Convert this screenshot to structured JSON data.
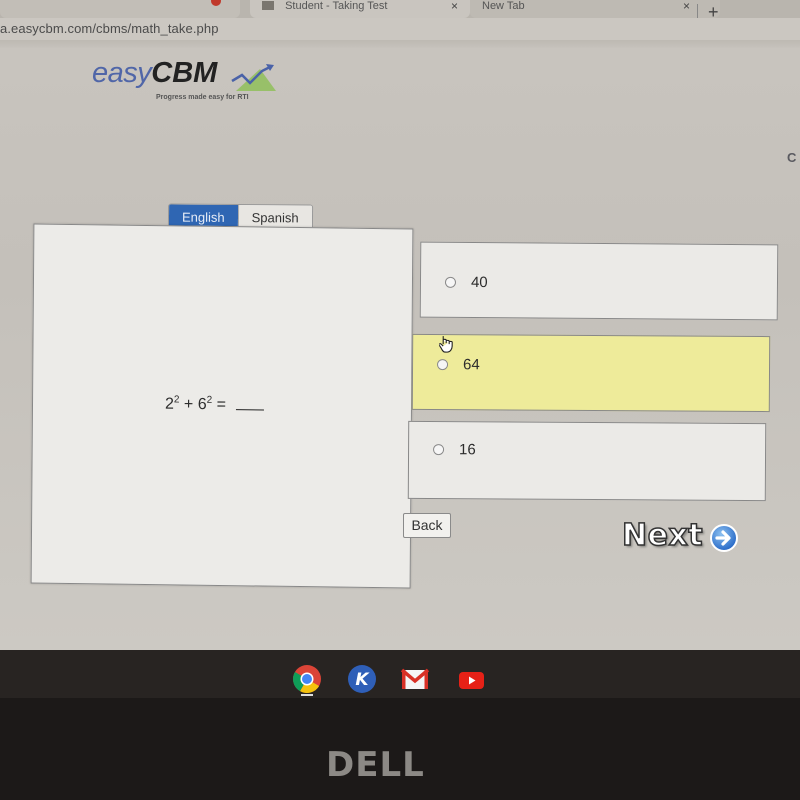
{
  "browser": {
    "tabs": [
      {
        "title": "Student - Taking Test",
        "close": "×"
      },
      {
        "title": "New Tab",
        "close": "×"
      }
    ],
    "new_tab": "+",
    "url": "a.easycbm.com/cbms/math_take.php"
  },
  "header": {
    "logo_easy": "easy",
    "logo_cbm": "CBM",
    "tagline": "Progress made easy for RTI",
    "corner_text": "C"
  },
  "language": {
    "options": [
      "English",
      "Spanish"
    ],
    "selected": "English"
  },
  "question": {
    "base1": "2",
    "exp1": "2",
    "op": "+",
    "base2": "6",
    "exp2": "2",
    "equals": "="
  },
  "choices": [
    {
      "label": "40",
      "highlighted": false
    },
    {
      "label": "64",
      "highlighted": true
    },
    {
      "label": "16",
      "highlighted": false
    }
  ],
  "nav": {
    "back_label": "Back",
    "next_label": "Next"
  },
  "shelf": {
    "apps": [
      "chrome-icon",
      "k-app-icon",
      "gmail-icon",
      "youtube-icon"
    ]
  },
  "device": {
    "brand": "DELL"
  },
  "colors": {
    "active_lang": "#2f66b3",
    "highlight_choice": "#eeeb9a",
    "logo_blue": "#5066a8"
  }
}
